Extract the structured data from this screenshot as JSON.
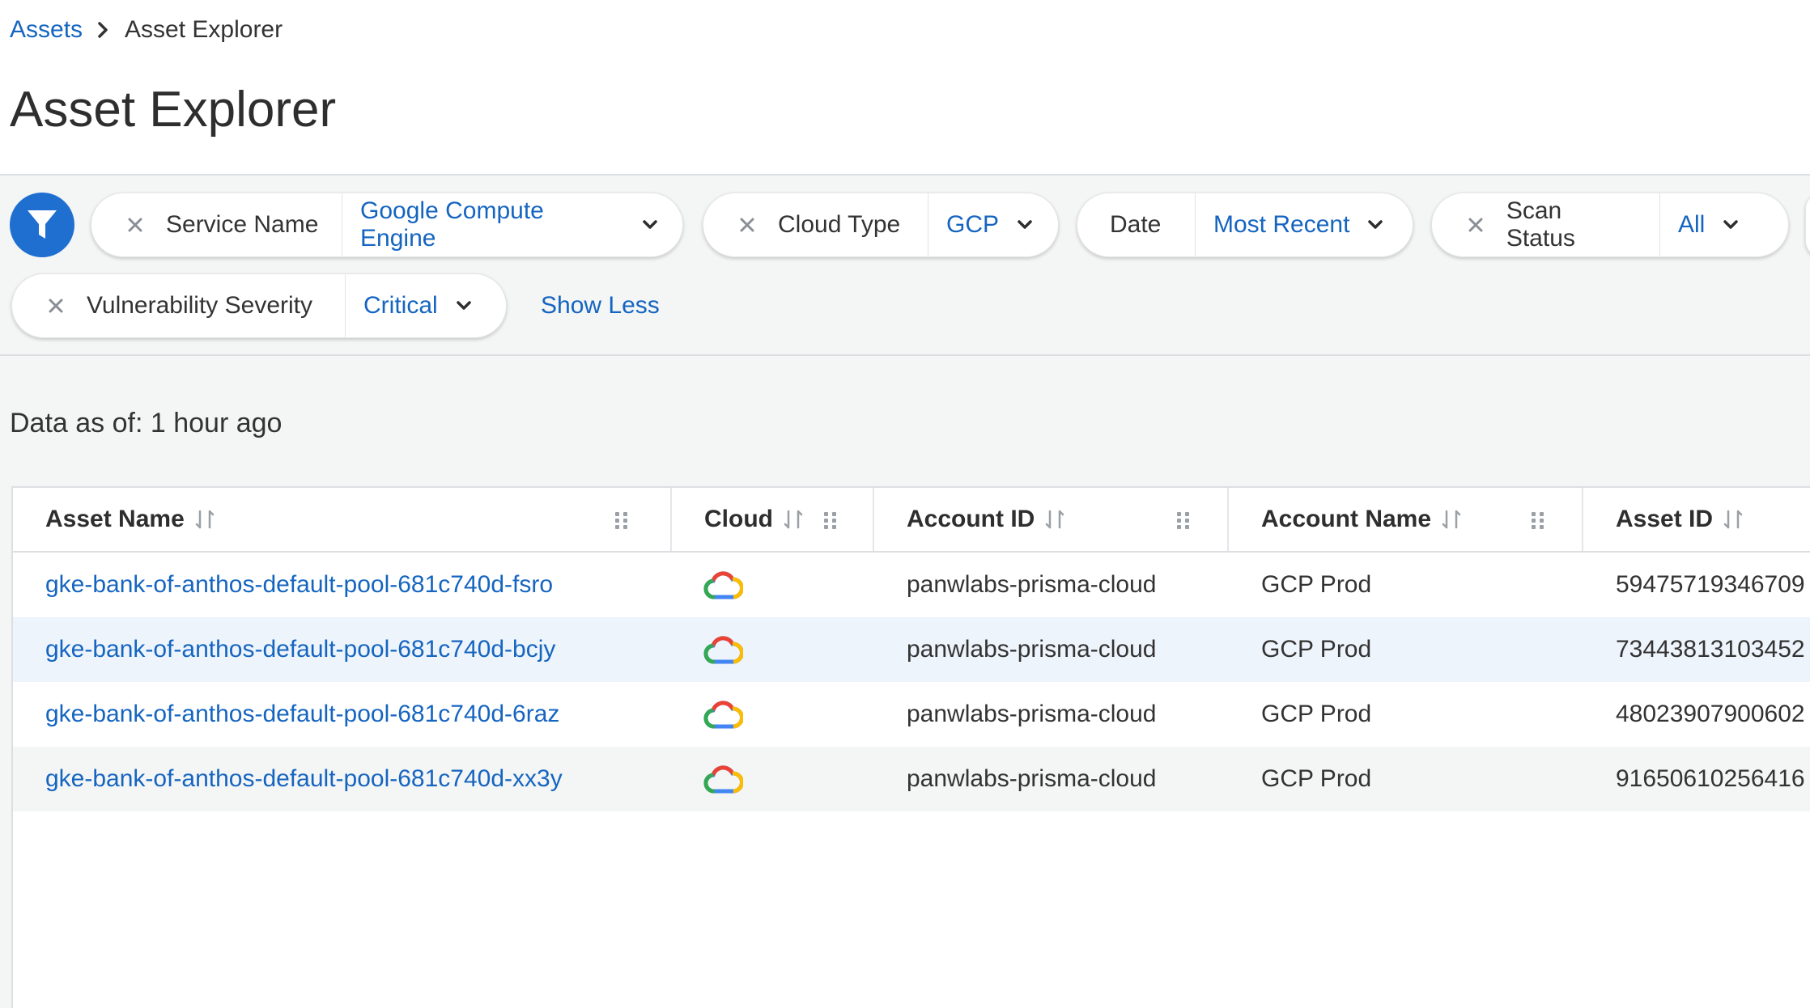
{
  "breadcrumb": {
    "root": "Assets",
    "current": "Asset Explorer"
  },
  "page_title": "Asset Explorer",
  "filters": [
    {
      "key": "Service Name",
      "value": "Google Compute Engine",
      "removable": true
    },
    {
      "key": "Cloud Type",
      "value": "GCP",
      "removable": true
    },
    {
      "key": "Date",
      "value": "Most Recent",
      "removable": false
    },
    {
      "key": "Scan Status",
      "value": "All",
      "removable": true
    },
    {
      "key": "Vulnerability Severity",
      "value": "Critical",
      "removable": true
    }
  ],
  "show_less_label": "Show Less",
  "data_as_of": "Data as of: 1 hour ago",
  "table": {
    "columns": [
      "Asset Name",
      "Cloud",
      "Account ID",
      "Account Name",
      "Asset ID"
    ],
    "rows": [
      {
        "asset_name": "gke-bank-of-anthos-default-pool-681c740d-fsro",
        "cloud": "gcp-cloud-icon",
        "account_id": "panwlabs-prisma-cloud",
        "account_name": "GCP Prod",
        "asset_id": "59475719346709"
      },
      {
        "asset_name": "gke-bank-of-anthos-default-pool-681c740d-bcjy",
        "cloud": "gcp-cloud-icon",
        "account_id": "panwlabs-prisma-cloud",
        "account_name": "GCP Prod",
        "asset_id": "73443813103452"
      },
      {
        "asset_name": "gke-bank-of-anthos-default-pool-681c740d-6raz",
        "cloud": "gcp-cloud-icon",
        "account_id": "panwlabs-prisma-cloud",
        "account_name": "GCP Prod",
        "asset_id": "48023907900602"
      },
      {
        "asset_name": "gke-bank-of-anthos-default-pool-681c740d-xx3y",
        "cloud": "gcp-cloud-icon",
        "account_id": "panwlabs-prisma-cloud",
        "account_name": "GCP Prod",
        "asset_id": "91650610256416"
      }
    ]
  },
  "colors": {
    "accent": "#1565c0",
    "filter_button": "#1e6fd0",
    "row_highlight": "#eef4fb"
  }
}
